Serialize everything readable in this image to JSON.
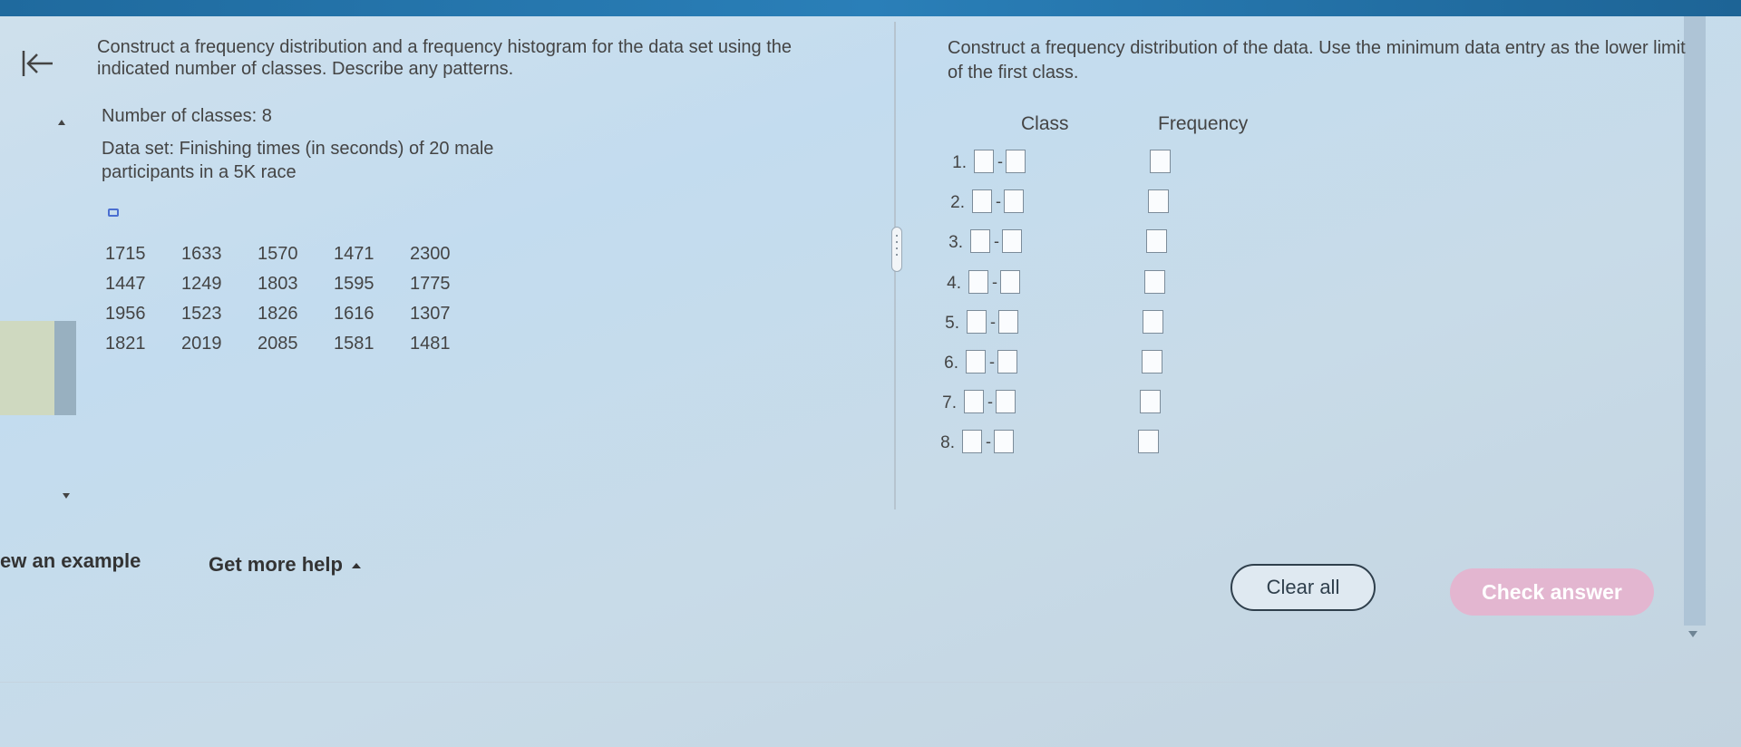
{
  "left_panel": {
    "prompt": "Construct a frequency distribution and a frequency histogram for the data set using the indicated number of classes. Describe any patterns.",
    "number_of_classes": "Number of classes: 8",
    "data_set_description": "Data set: Finishing times (in seconds) of 20 male participants in a 5K race",
    "data_rows": [
      [
        "1715",
        "1633",
        "1570",
        "1471",
        "2300"
      ],
      [
        "1447",
        "1249",
        "1803",
        "1595",
        "1775"
      ],
      [
        "1956",
        "1523",
        "1826",
        "1616",
        "1307"
      ],
      [
        "1821",
        "2019",
        "2085",
        "1581",
        "1481"
      ]
    ]
  },
  "right_panel": {
    "prompt": "Construct a frequency distribution of the data. Use the minimum data entry as the lower limit of the first class.",
    "column_class": "Class",
    "column_frequency": "Frequency",
    "class_separator": "-",
    "rows": [
      {
        "num": "1.",
        "lower": "",
        "upper": "",
        "frequency": ""
      },
      {
        "num": "2.",
        "lower": "",
        "upper": "",
        "frequency": ""
      },
      {
        "num": "3.",
        "lower": "",
        "upper": "",
        "frequency": ""
      },
      {
        "num": "4.",
        "lower": "",
        "upper": "",
        "frequency": ""
      },
      {
        "num": "5.",
        "lower": "",
        "upper": "",
        "frequency": ""
      },
      {
        "num": "6.",
        "lower": "",
        "upper": "",
        "frequency": ""
      },
      {
        "num": "7.",
        "lower": "",
        "upper": "",
        "frequency": ""
      },
      {
        "num": "8.",
        "lower": "",
        "upper": "",
        "frequency": ""
      }
    ]
  },
  "footer": {
    "view_example": "ew an example",
    "get_more_help": "Get more help",
    "clear_all": "Clear all",
    "check_answer": "Check answer"
  },
  "icons": {
    "back": "back-to-start-icon",
    "copy": "copy-data-icon",
    "splitter": "panel-splitter-handle",
    "help_caret": "caret-up-icon"
  },
  "colors": {
    "top_bar": "#2a7fb8",
    "check_answer_bg": "#e3b6d0",
    "clear_all_border": "#2f3f4c"
  }
}
